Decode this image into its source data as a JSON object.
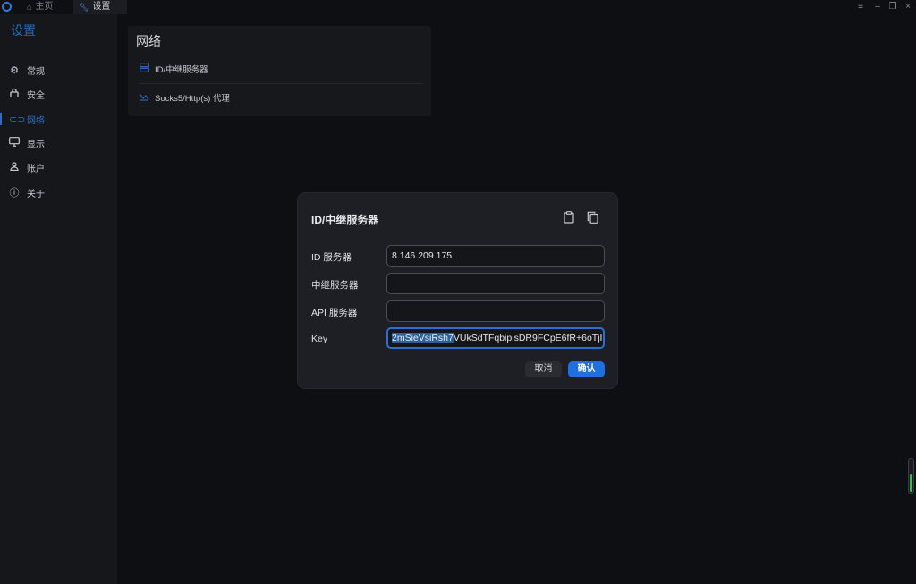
{
  "window": {
    "tabs": [
      {
        "label": "主页",
        "icon": "home-icon"
      },
      {
        "label": "设置",
        "icon": "wrench-icon"
      }
    ],
    "controls": {
      "menu": "≡",
      "minimize": "–",
      "restore": "❐",
      "close": "×"
    }
  },
  "sidebar": {
    "title": "设置",
    "items": [
      {
        "label": "常规",
        "icon": "gear-icon"
      },
      {
        "label": "安全",
        "icon": "lock-icon"
      },
      {
        "label": "网络",
        "icon": "link-icon",
        "active": true
      },
      {
        "label": "显示",
        "icon": "monitor-icon"
      },
      {
        "label": "账户",
        "icon": "user-icon"
      },
      {
        "label": "关于",
        "icon": "info-icon"
      }
    ]
  },
  "network_card": {
    "title": "网络",
    "rows": [
      {
        "label": "ID/中继服务器",
        "icon": "server-icon"
      },
      {
        "label": "Socks5/Http(s) 代理",
        "icon": "proxy-icon"
      }
    ]
  },
  "dialog": {
    "title": "ID/中继服务器",
    "icons": [
      "clipboard-icon",
      "copy-icon"
    ],
    "fields": {
      "id_server": {
        "label": "ID 服务器",
        "value": "8.146.209.175"
      },
      "relay_server": {
        "label": "中继服务器",
        "value": ""
      },
      "api_server": {
        "label": "API 服务器",
        "value": ""
      },
      "key": {
        "label": "Key",
        "value_selected": "2mSieVsiRsh7",
        "value_rest": "VUkSdTFqbipisDR9FCpE6fR+6oTjI"
      }
    },
    "buttons": {
      "cancel": "取消",
      "ok": "确认"
    }
  },
  "colors": {
    "accent": "#1e6fdf",
    "sidebar_bg": "#16171b",
    "dialog_bg": "#1d1f24",
    "indicator": "#2fbf4a"
  },
  "scroll_indicator": {
    "level": 0.55
  }
}
